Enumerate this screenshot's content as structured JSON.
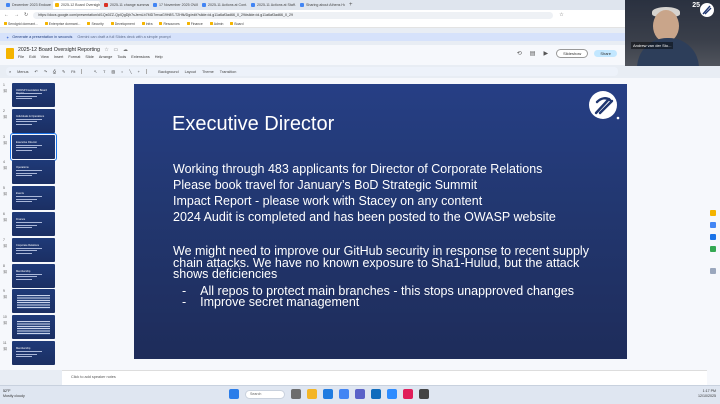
{
  "browser": {
    "tabs": [
      {
        "label": "December 2023 Endowment...",
        "color": "#4285f4"
      },
      {
        "label": "2025-12 Board Oversight Repo...",
        "color": "#f4b400",
        "active": true
      },
      {
        "label": "2025-11 change summary.pdf",
        "color": "#d93025"
      },
      {
        "label": "17 November 2025 OWASP Exec...",
        "color": "#4285f4"
      },
      {
        "label": "2025-11 Actions at Cont...",
        "color": "#4285f4"
      },
      {
        "label": "2025-11 Actions at Staff...",
        "color": "#4285f4"
      },
      {
        "label": "Sharing about Athens Homepage...",
        "color": "#4285f4"
      }
    ],
    "url": "https://docs.google.com/presentation/d/1Qs9ZZ-QpIQgDjh7sJemLb7MD7mvaG9H8S-T2Hfk/Dg/edit?slide=id.g11a6af3ad66_0_29#slide=id.g11a6af3ad66_0_29",
    "bookmarks": [
      "Sendgrid dormant...",
      "Enterprise dormant...",
      "Security",
      "Development",
      "Infra",
      "Resources",
      "Finance",
      "Admin",
      "Board"
    ]
  },
  "gemini": {
    "message": "Generate a presentation in seconds",
    "sub": "Gemini can draft a full Slides deck with a simple prompt"
  },
  "doc": {
    "title": "2025-12 Board Oversight Reporting",
    "menus": [
      "File",
      "Edit",
      "View",
      "Insert",
      "Format",
      "Slide",
      "Arrange",
      "Tools",
      "Extensions",
      "Help"
    ],
    "slideshow_label": "Slideshow",
    "share_label": "Share"
  },
  "toolbar": {
    "menus_label": "Menus",
    "zoom": "Fit",
    "items": [
      "Background",
      "Layout",
      "Theme",
      "Transition"
    ]
  },
  "filmstrip": {
    "slides": [
      {
        "num": "1",
        "title": "OWASP Foundation Board Report",
        "kind": "title"
      },
      {
        "num": "2",
        "title": "Individuals & Operations",
        "kind": "text"
      },
      {
        "num": "3",
        "title": "Executive Director",
        "kind": "text",
        "selected": true
      },
      {
        "num": "4",
        "title": "Operations",
        "kind": "text"
      },
      {
        "num": "5",
        "title": "Events",
        "kind": "text"
      },
      {
        "num": "6",
        "title": "Finance",
        "kind": "text"
      },
      {
        "num": "7",
        "title": "Corporate Relations",
        "kind": "text"
      },
      {
        "num": "8",
        "title": "Membership",
        "kind": "text"
      },
      {
        "num": "9",
        "title": "",
        "kind": "table"
      },
      {
        "num": "10",
        "title": "",
        "kind": "table"
      },
      {
        "num": "11",
        "title": "Membership",
        "kind": "text"
      }
    ]
  },
  "slide": {
    "title": "Executive Director",
    "bullets": [
      "Working through 483 applicants for Director of Corporate Relations",
      "Please book travel for January’s BoD Strategic Summit",
      "Impact Report - please work with Stacey on any content",
      "2024 Audit is completed and has been posted to the OWASP website"
    ],
    "paragraph": "We might need to improve our GitHub security in response to recent supply chain attacks. We have no known exposure to Sha1-Hulud, but the attack shows deficiencies",
    "sub_bullets": [
      "All repos to protect main branches - this stops unapproved changes",
      "Improve secret management"
    ],
    "sub_marker": "-"
  },
  "notes": {
    "placeholder": "Click to add speaker notes"
  },
  "webcam": {
    "name": "Andrew van der Sto...",
    "badge": "25"
  },
  "taskbar": {
    "weather_temp": "52°F",
    "weather_desc": "Mostly cloudy",
    "search_placeholder": "Search",
    "time": "1:17 PM",
    "date": "12/10/2025"
  }
}
